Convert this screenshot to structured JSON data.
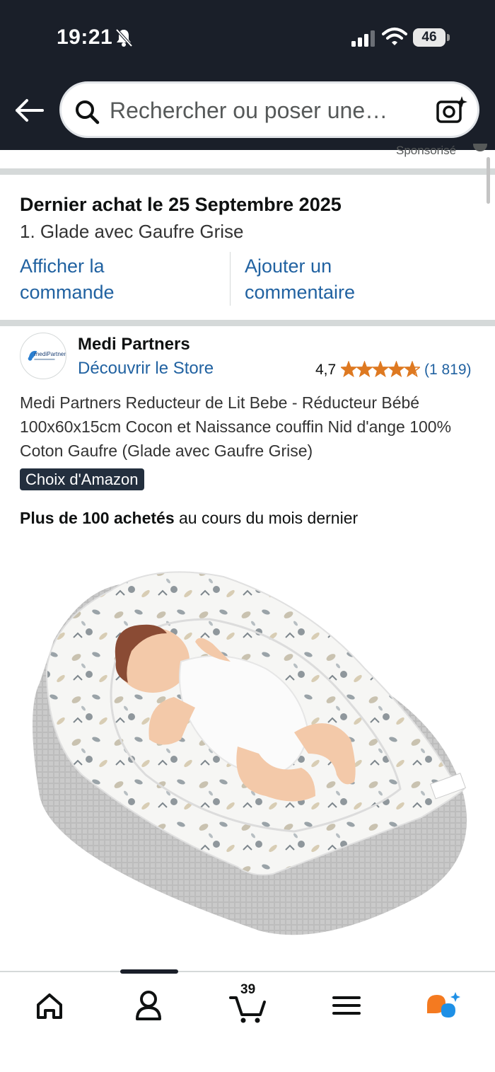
{
  "status_bar": {
    "time": "19:21",
    "battery": "46",
    "icons": [
      "bell-off-icon",
      "signal-icon",
      "wifi-icon",
      "battery-icon"
    ]
  },
  "header": {
    "search_placeholder": "Rechercher ou poser une…",
    "icons": [
      "back-arrow-icon",
      "search-icon",
      "camera-sparkle-icon"
    ]
  },
  "sponsored_label": "Sponsorisé",
  "last_order": {
    "title": "Dernier achat le 25 Septembre 2025",
    "item": "1. Glade avec Gaufre Grise",
    "view_order": "Afficher la commande",
    "add_comment": "Ajouter un commentaire"
  },
  "product": {
    "brand": "Medi Partners",
    "brand_logo_text": "mediPartners",
    "store_link": "Découvrir le Store",
    "rating": "4,7",
    "rating_value": 4.7,
    "rating_count": "(1 819)",
    "title": "Medi Partners Reducteur de Lit Bebe - Réducteur Bébé 100x60x15cm Cocon et Naissance couffin Nid d'ange 100% Coton Gaufre (Glade avec Gaufre Grise)",
    "badge": "Choix d'Amazon",
    "bought_strong": "Plus de 100 achetés",
    "bought_rest": " au cours du mois dernier"
  },
  "bottom_nav": {
    "items": [
      "home-icon",
      "account-icon",
      "cart-icon",
      "menu-icon",
      "rufus-icon"
    ],
    "cart_count": "39"
  },
  "colors": {
    "header_bg": "#1a1f29",
    "link": "#2162a1",
    "star": "#de7921",
    "badge_bg": "#232f3e"
  }
}
